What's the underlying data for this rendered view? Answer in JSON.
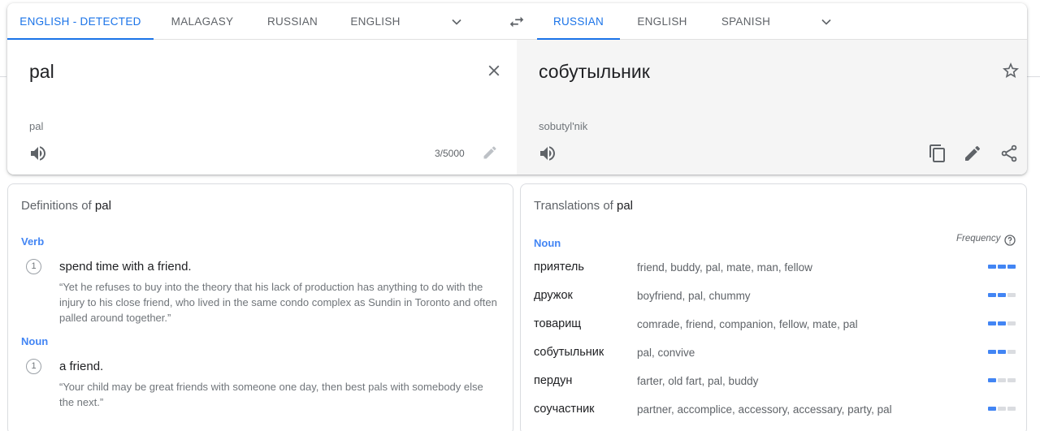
{
  "source_tabs": [
    "ENGLISH - DETECTED",
    "MALAGASY",
    "RUSSIAN",
    "ENGLISH"
  ],
  "target_tabs": [
    "RUSSIAN",
    "ENGLISH",
    "SPANISH"
  ],
  "source": {
    "text": "pal",
    "transliteration": "pal",
    "char_count": "3/5000"
  },
  "target": {
    "text": "собутыльник",
    "transliteration": "sobutyl'nik"
  },
  "definitions": {
    "title_prefix": "Definitions of",
    "word": "pal",
    "groups": [
      {
        "pos": "Verb",
        "entries": [
          {
            "num": "1",
            "gloss": "spend time with a friend.",
            "example": "“Yet he refuses to buy into the theory that his lack of production has anything to do with the injury to his close friend, who lived in the same condo complex as Sundin in Toronto and often palled around together.”"
          }
        ]
      },
      {
        "pos": "Noun",
        "entries": [
          {
            "num": "1",
            "gloss": "a friend.",
            "example": "“Your child may be great friends with someone one day, then best pals with somebody else the next.”"
          }
        ]
      }
    ]
  },
  "translations": {
    "title_prefix": "Translations of",
    "word": "pal",
    "pos": "Noun",
    "frequency_label": "Frequency",
    "rows": [
      {
        "word": "приятель",
        "synonyms": "friend, buddy, pal, mate, man, fellow",
        "frequency": 3
      },
      {
        "word": "дружок",
        "synonyms": "boyfriend, pal, chummy",
        "frequency": 2
      },
      {
        "word": "товарищ",
        "synonyms": "comrade, friend, companion, fellow, mate, pal",
        "frequency": 2
      },
      {
        "word": "собутыльник",
        "synonyms": "pal, convive",
        "frequency": 2
      },
      {
        "word": "пердун",
        "synonyms": "farter, old fart, pal, buddy",
        "frequency": 1
      },
      {
        "word": "соучастник",
        "synonyms": "partner, accomplice, accessory, accessary, party, pal",
        "frequency": 1
      }
    ]
  },
  "colors": {
    "accent": "#1a73e8",
    "pos_label": "#4285f4",
    "target_bg": "#f5f5f5",
    "freq_on": "#4285f4",
    "freq_off": "#dadce0"
  },
  "icons": {
    "swap": "swap-horiz-icon",
    "clear": "close-icon",
    "star": "star-outline-icon",
    "speak": "volume-icon",
    "edit": "pencil-icon",
    "copy": "copy-icon",
    "share": "share-icon",
    "more_langs": "chevron-down-icon",
    "help": "help-circle-icon"
  }
}
